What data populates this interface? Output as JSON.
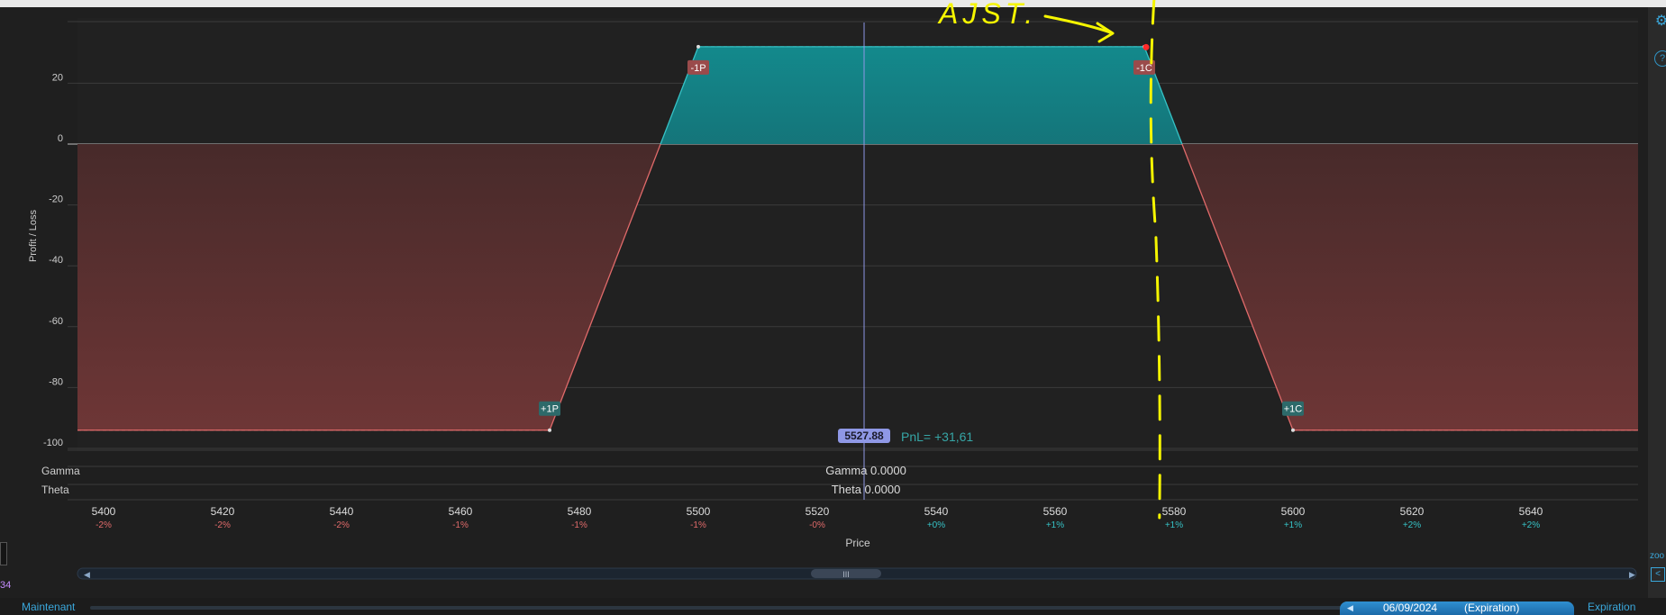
{
  "chart_data": {
    "type": "area",
    "title": "",
    "xlabel": "Price",
    "ylabel": "Profit / Loss",
    "xlim": [
      5395,
      5675
    ],
    "ylim": [
      -100,
      40
    ],
    "x_ticks": [
      5400,
      5420,
      5440,
      5460,
      5480,
      5500,
      5520,
      5540,
      5560,
      5580,
      5600,
      5620,
      5640
    ],
    "x_pct_labels": [
      "-2%",
      "-2%",
      "-2%",
      "-1%",
      "-1%",
      "-1%",
      "-0%",
      "+0%",
      "+1%",
      "+1%",
      "+1%",
      "+2%",
      "+2%"
    ],
    "y_ticks": [
      20,
      0,
      -20,
      -40,
      -60,
      -80,
      -100
    ],
    "series": [
      {
        "x": [
          5395,
          5475,
          5500,
          5575,
          5600,
          5675
        ],
        "y": [
          -94,
          -94,
          32,
          32,
          -94,
          -94
        ]
      }
    ],
    "legs": [
      {
        "label": "+1P",
        "x": 5475,
        "y": -94,
        "color": "#2d6a6a"
      },
      {
        "label": "-1P",
        "x": 5500,
        "y": 32,
        "color": "#9a4b4b"
      },
      {
        "label": "-1C",
        "x": 5575,
        "y": 32,
        "color": "#9a4b4b"
      },
      {
        "label": "+1C",
        "x": 5600,
        "y": -94,
        "color": "#2d6a6a"
      }
    ],
    "current_price": 5527.88,
    "current_price_label": "5527.88",
    "pnl_label": "PnL= +31,61",
    "gamma": {
      "label": "Gamma",
      "value_text": "Gamma 0.0000"
    },
    "theta": {
      "label": "Theta",
      "value_text": "Theta 0.0000"
    },
    "annotation": {
      "text": "AJST.",
      "dashed_line_x": 5573,
      "color": "#f5f500"
    },
    "grid": true,
    "colors": {
      "profit": "#13898c",
      "loss": "#6a3434",
      "loss_line": "#e06a6a",
      "profit_line": "#36c2c6",
      "price_line": "#8f98e6",
      "price_badge": "#8f98e6",
      "pct_negative": "#e06a6a",
      "pct_positive": "#36c2c6",
      "pnl_text": "#36a6a6"
    }
  },
  "bottom": {
    "now_label": "Maintenant",
    "date": "06/09/2024",
    "date_suffix": "(Expiration)",
    "expiration_label": "Expiration"
  },
  "side": {
    "gear_icon": "gear-icon",
    "help_icon": "help-icon",
    "help_glyph": "?",
    "zoom_label": "zoo",
    "zoom_btn": "<",
    "left_value": "34"
  }
}
